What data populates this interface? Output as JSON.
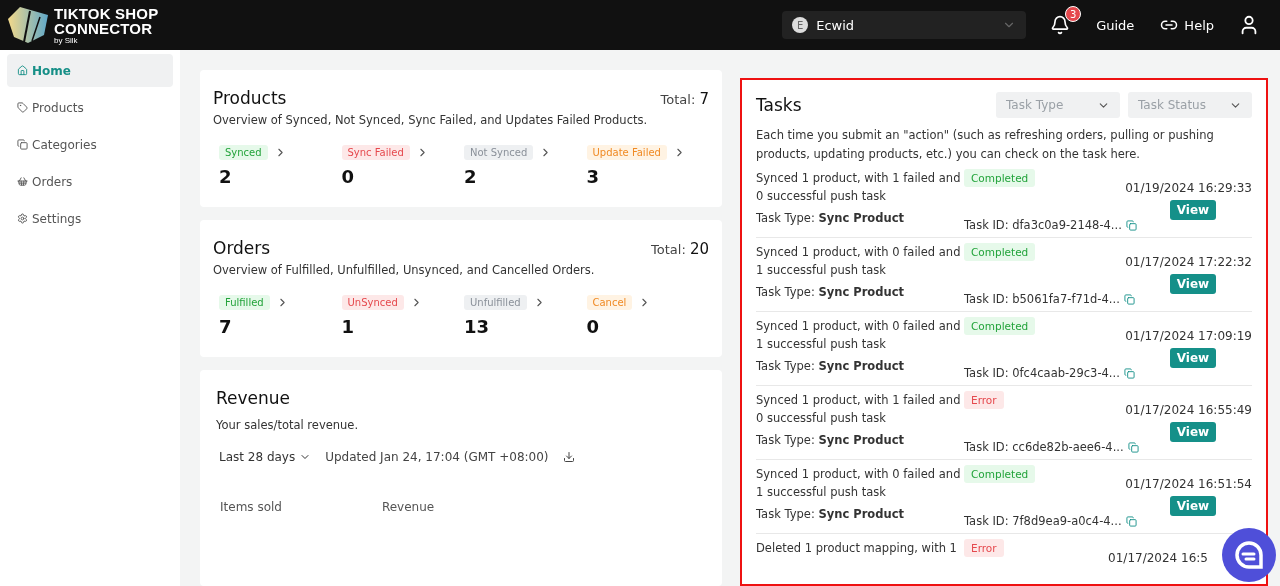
{
  "header": {
    "logo": {
      "line1": "TIKTOK SHOP",
      "line2": "CONNECTOR",
      "tagline": "by Silk"
    },
    "store": {
      "initial": "E",
      "name": "Ecwid"
    },
    "notifications": "3",
    "links": [
      {
        "label": "Guide",
        "kind": "plain"
      },
      {
        "label": "Help",
        "kind": "link"
      }
    ]
  },
  "sidebar": {
    "items": [
      {
        "label": "Home",
        "selected": true
      },
      {
        "label": "Products",
        "selected": false
      },
      {
        "label": "Categories",
        "selected": false
      },
      {
        "label": "Orders",
        "selected": false
      },
      {
        "label": "Settings",
        "selected": false
      }
    ]
  },
  "summaries": [
    {
      "title": "Products",
      "subtitle": "Overview of Synced, Not Synced, Sync Failed, and Updates Failed Products.",
      "total_label": "Total:",
      "total": "7",
      "stats": [
        {
          "label": "Synced",
          "kind": "success",
          "value": "2"
        },
        {
          "label": "Sync Failed",
          "kind": "danger",
          "value": "0"
        },
        {
          "label": "Not Synced",
          "kind": "neutral",
          "value": "2"
        },
        {
          "label": "Update Failed",
          "kind": "warning",
          "value": "3"
        }
      ]
    },
    {
      "title": "Orders",
      "subtitle": "Overview of Fulfilled, Unfulfilled, Unsynced, and Cancelled Orders.",
      "total_label": "Total:",
      "total": "20",
      "stats": [
        {
          "label": "Fulfilled",
          "kind": "success",
          "value": "7"
        },
        {
          "label": "UnSynced",
          "kind": "danger",
          "value": "1"
        },
        {
          "label": "Unfulfilled",
          "kind": "neutral",
          "value": "13"
        },
        {
          "label": "Cancel",
          "kind": "warning",
          "value": "0"
        }
      ]
    }
  ],
  "revenue": {
    "title": "Revenue",
    "subtitle": "Your sales/total revenue.",
    "period": "Last 28 days",
    "updated": "Updated Jan 24, 17:04 (GMT +08:00)",
    "columns": [
      "Items sold",
      "Revenue"
    ]
  },
  "tasks": {
    "title": "Tasks",
    "highlighted": true,
    "filters": [
      {
        "placeholder": "Task Type"
      },
      {
        "placeholder": "Task Status"
      }
    ],
    "intro": "Each time you submit an \"action\" (such as refreshing orders, pulling or pushing products, updating products, etc.) you can check on the task here.",
    "items": [
      {
        "description": "Synced 1 product, with 1 failed and 0 successful push task",
        "status": {
          "label": "Completed",
          "kind": "success"
        },
        "type_label": "Task Type:",
        "type": "Sync Product",
        "task_id": "Task ID: dfa3c0a9-2148-4...",
        "date": "01/19/2024 16:29:33",
        "action": "View"
      },
      {
        "description": "Synced 1 product, with 0 failed and 1 successful push task",
        "status": {
          "label": "Completed",
          "kind": "success"
        },
        "type_label": "Task Type:",
        "type": "Sync Product",
        "task_id": "Task ID: b5061fa7-f71d-4...",
        "date": "01/17/2024 17:22:32",
        "action": "View"
      },
      {
        "description": "Synced 1 product, with 0 failed and 1 successful push task",
        "status": {
          "label": "Completed",
          "kind": "success"
        },
        "type_label": "Task Type:",
        "type": "Sync Product",
        "task_id": "Task ID: 0fc4caab-29c3-4...",
        "date": "01/17/2024 17:09:19",
        "action": "View"
      },
      {
        "description": "Synced 1 product, with 1 failed and 0 successful push task",
        "status": {
          "label": "Error",
          "kind": "danger"
        },
        "type_label": "Task Type:",
        "type": "Sync Product",
        "task_id": "Task ID: cc6de82b-aee6-4...",
        "date": "01/17/2024 16:55:49",
        "action": "View"
      },
      {
        "description": "Synced 1 product, with 0 failed and 1 successful push task",
        "status": {
          "label": "Completed",
          "kind": "success"
        },
        "type_label": "Task Type:",
        "type": "Sync Product",
        "task_id": "Task ID: 7f8d9ea9-a0c4-4...",
        "date": "01/17/2024 16:51:54",
        "action": "View"
      },
      {
        "description": "Deleted 1 product mapping, with 1",
        "status": {
          "label": "Error",
          "kind": "danger"
        },
        "date": "01/17/2024 16:5"
      }
    ]
  }
}
